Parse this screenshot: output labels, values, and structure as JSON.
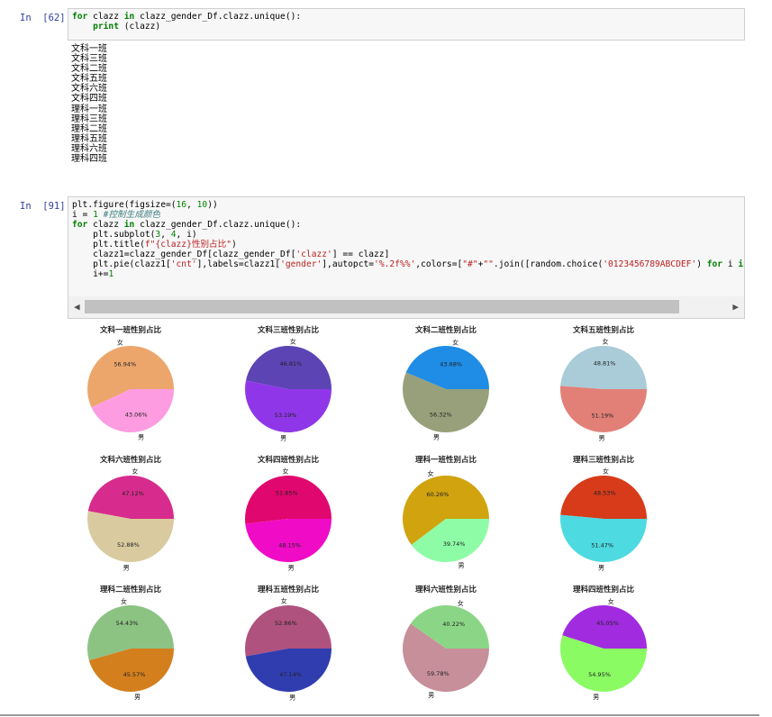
{
  "cell1": {
    "prompt": "In  [62]:",
    "code": [
      [
        {
          "t": "for",
          "c": "kw"
        },
        {
          "t": " clazz "
        },
        {
          "t": "in",
          "c": "kw"
        },
        {
          "t": " clazz_gender_Df.clazz.unique():"
        }
      ],
      [
        {
          "t": "    "
        },
        {
          "t": "print",
          "c": "kw"
        },
        {
          "t": " (clazz)"
        }
      ]
    ],
    "output": [
      "文科一班",
      "文科三班",
      "文科二班",
      "文科五班",
      "文科六班",
      "文科四班",
      "理科一班",
      "理科三班",
      "理科二班",
      "理科五班",
      "理科六班",
      "理科四班"
    ]
  },
  "cell2": {
    "prompt": "In  [91]:",
    "code": [
      [
        {
          "t": "plt.figure(figsize=("
        },
        {
          "t": "16",
          "c": "num"
        },
        {
          "t": ", "
        },
        {
          "t": "10",
          "c": "num"
        },
        {
          "t": "))"
        }
      ],
      [
        {
          "t": "i = "
        },
        {
          "t": "1",
          "c": "num"
        },
        {
          "t": " "
        },
        {
          "t": "#控制生成颜色",
          "c": "cm"
        }
      ],
      [
        {
          "t": "for",
          "c": "kw"
        },
        {
          "t": " clazz "
        },
        {
          "t": "in",
          "c": "kw"
        },
        {
          "t": " clazz_gender_Df.clazz.unique():"
        }
      ],
      [
        {
          "t": "    plt.subplot("
        },
        {
          "t": "3",
          "c": "num"
        },
        {
          "t": ", "
        },
        {
          "t": "4",
          "c": "num"
        },
        {
          "t": ", i)"
        }
      ],
      [
        {
          "t": "    plt.title("
        },
        {
          "t": "f\"{clazz}性别占比\"",
          "c": "str"
        },
        {
          "t": ")"
        }
      ],
      [
        {
          "t": "    clazz1=clazz_gender_Df[clazz_gender_Df["
        },
        {
          "t": "'clazz'",
          "c": "str"
        },
        {
          "t": "] == clazz]"
        }
      ],
      [
        {
          "t": "    plt.pie(clazz1["
        },
        {
          "t": "'cnt'",
          "c": "str"
        },
        {
          "t": "],labels=clazz1["
        },
        {
          "t": "'gender'",
          "c": "str"
        },
        {
          "t": "],autopct="
        },
        {
          "t": "'%.2f%%'",
          "c": "str"
        },
        {
          "t": ",colors=["
        },
        {
          "t": "\"#\"",
          "c": "str"
        },
        {
          "t": "+"
        },
        {
          "t": "\"\"",
          "c": "str"
        },
        {
          "t": ".join([random.choice("
        },
        {
          "t": "'0123456789ABCDEF'",
          "c": "str"
        },
        {
          "t": ") "
        },
        {
          "t": "for",
          "c": "kw"
        },
        {
          "t": " i "
        },
        {
          "t": "in",
          "c": "kw"
        },
        {
          "t": " range("
        },
        {
          "t": "6",
          "c": "num"
        },
        {
          "t": ")]) :"
        }
      ],
      [
        {
          "t": "    i+="
        },
        {
          "t": "1",
          "c": "num"
        }
      ]
    ]
  },
  "chart_data": [
    {
      "type": "pie",
      "title": "文科一班性别占比",
      "labels": [
        "女",
        "男"
      ],
      "values": [
        56.94,
        43.06
      ],
      "autopct": [
        "56.94%",
        "43.06%"
      ],
      "colors": [
        "#ECA66C",
        "#FD9CE0"
      ]
    },
    {
      "type": "pie",
      "title": "文科三班性别占比",
      "labels": [
        "女",
        "男"
      ],
      "values": [
        46.81,
        53.19
      ],
      "autopct": [
        "46.81%",
        "53.19%"
      ],
      "colors": [
        "#5D44B4",
        "#8F37E8"
      ]
    },
    {
      "type": "pie",
      "title": "文科二班性别占比",
      "labels": [
        "女",
        "男"
      ],
      "values": [
        43.68,
        56.32
      ],
      "autopct": [
        "43.68%",
        "56.32%"
      ],
      "colors": [
        "#1F8CE6",
        "#97A07A"
      ]
    },
    {
      "type": "pie",
      "title": "文科五班性别占比",
      "labels": [
        "女",
        "男"
      ],
      "values": [
        48.81,
        51.19
      ],
      "autopct": [
        "48.81%",
        "51.19%"
      ],
      "colors": [
        "#A9CCD8",
        "#E28078"
      ]
    },
    {
      "type": "pie",
      "title": "文科六班性别占比",
      "labels": [
        "女",
        "男"
      ],
      "values": [
        47.12,
        52.88
      ],
      "autopct": [
        "47.12%",
        "52.88%"
      ],
      "colors": [
        "#D72C8D",
        "#D9CB9F"
      ]
    },
    {
      "type": "pie",
      "title": "文科四班性别占比",
      "labels": [
        "女",
        "男"
      ],
      "values": [
        51.85,
        48.15
      ],
      "autopct": [
        "51.85%",
        "48.15%"
      ],
      "colors": [
        "#E0076E",
        "#F00BC6"
      ]
    },
    {
      "type": "pie",
      "title": "理科一班性别占比",
      "labels": [
        "女",
        "男"
      ],
      "values": [
        60.26,
        39.74
      ],
      "autopct": [
        "60.26%",
        "39.74%"
      ],
      "colors": [
        "#D0A30F",
        "#8EFCA6"
      ]
    },
    {
      "type": "pie",
      "title": "理科三班性别占比",
      "labels": [
        "女",
        "男"
      ],
      "values": [
        48.53,
        51.47
      ],
      "autopct": [
        "48.53%",
        "51.47%"
      ],
      "colors": [
        "#D73B1A",
        "#4DDAE1"
      ]
    },
    {
      "type": "pie",
      "title": "理科二班性别占比",
      "labels": [
        "女",
        "男"
      ],
      "values": [
        54.43,
        45.57
      ],
      "autopct": [
        "54.43%",
        "45.57%"
      ],
      "colors": [
        "#8CC383",
        "#D47F1E"
      ]
    },
    {
      "type": "pie",
      "title": "理科五班性别占比",
      "labels": [
        "女",
        "男"
      ],
      "values": [
        52.86,
        47.14
      ],
      "autopct": [
        "52.86%",
        "47.14%"
      ],
      "colors": [
        "#B0527E",
        "#303DAF"
      ]
    },
    {
      "type": "pie",
      "title": "理科六班性别占比",
      "labels": [
        "女",
        "男"
      ],
      "values": [
        40.22,
        59.78
      ],
      "autopct": [
        "40.22%",
        "59.78%"
      ],
      "colors": [
        "#8BD686",
        "#C68F9A"
      ]
    },
    {
      "type": "pie",
      "title": "理科四班性别占比",
      "labels": [
        "女",
        "男"
      ],
      "values": [
        45.05,
        54.95
      ],
      "autopct": [
        "45.05%",
        "54.95%"
      ],
      "colors": [
        "#A12BDF",
        "#8BFB64"
      ]
    }
  ]
}
